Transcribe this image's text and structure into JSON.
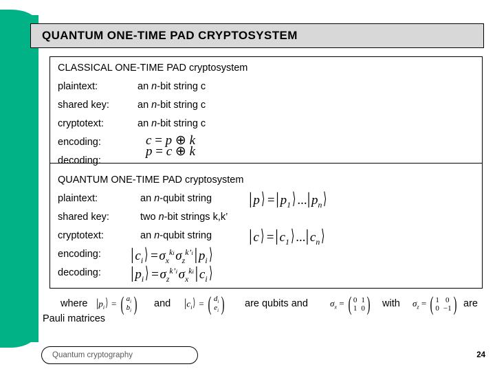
{
  "slide": {
    "title": "QUANTUM ONE-TIME PAD CRYPTOSYSTEM",
    "footer_label": "Quantum cryptography",
    "page_number": "24",
    "accent_color": "#00b285",
    "title_bar_color": "#d8d8d8"
  },
  "classical": {
    "heading": "CLASSICAL ONE-TIME PAD cryptosystem",
    "rows": [
      {
        "label": "plaintext:",
        "value_pre": "an ",
        "value_italic": "n",
        "value_post": "-bit string c"
      },
      {
        "label": "shared key:",
        "value_pre": "an ",
        "value_italic": "n",
        "value_post": "-bit string c"
      },
      {
        "label": "cryptotext:",
        "value_pre": "an ",
        "value_italic": "n",
        "value_post": "-bit string c"
      },
      {
        "label": "encoding:",
        "formula": "c = p ⊕ k"
      },
      {
        "label": "decoding:",
        "formula": "p = c ⊕ k"
      }
    ]
  },
  "quantum": {
    "heading": "QUANTUM ONE-TIME PAD cryptosystem",
    "rows": [
      {
        "label": "plaintext:",
        "value": "an n-qubit string",
        "formula": "| p 〉 = | p1 〉 ... | pn 〉"
      },
      {
        "label": "shared key:",
        "value": "two n-bit strings k,k'",
        "formula": ""
      },
      {
        "label": "cryptotext:",
        "value": "an n-qubit string",
        "formula": "| c 〉 = | c1 〉 ... | cn 〉"
      },
      {
        "label": "encoding:",
        "value": "",
        "formula": "| ci 〉 = σx^ki σz^k'i | pi 〉"
      },
      {
        "label": "decoding:",
        "value": "",
        "formula": "| pi 〉 = σz^k'i σx^ki | ci 〉"
      }
    ]
  },
  "where_line": {
    "word_where": "where",
    "formula_p": "| pi 〉 = ( ai bi )",
    "word_and": "and",
    "formula_c": "| ci 〉 = ( di ei )",
    "text_are_qubits_and": "are qubits and",
    "sigma_x_label": "σx = ( 0 1 / 1 0 )",
    "word_with": "with",
    "sigma_z_label": "σz = ( 1 0 / 0 −1 )",
    "word_are": "are",
    "text_pauli": "Pauli matrices"
  }
}
